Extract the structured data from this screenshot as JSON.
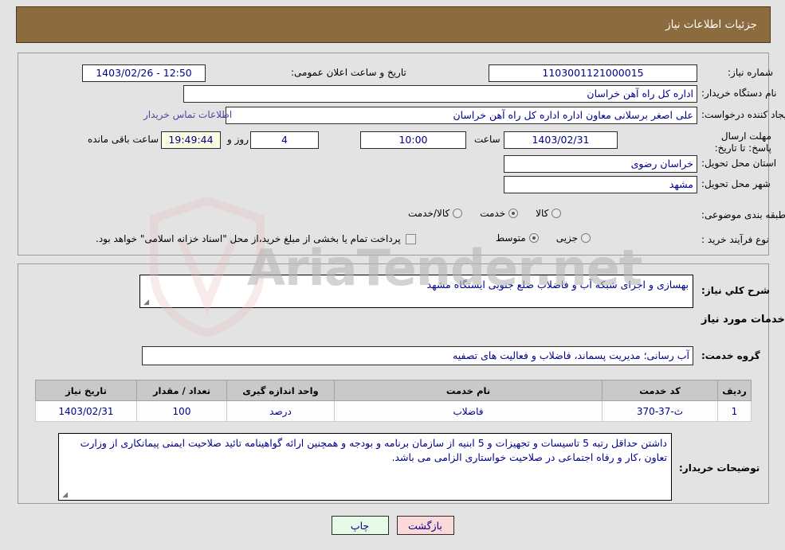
{
  "window": {
    "title": "جزئیات اطلاعات نیاز"
  },
  "watermark": {
    "text": "AriaTender.net"
  },
  "top_panel": {
    "need_number": {
      "label": "شماره نیاز:",
      "value": "1103001121000015"
    },
    "public_announce": {
      "label": "تاریخ و ساعت اعلان عمومی:",
      "value": "1403/02/26 - 12:50"
    },
    "buyer_org": {
      "label": "نام دستگاه خریدار:",
      "value": "اداره کل راه آهن خراسان"
    },
    "request_creator": {
      "label": "ایجاد کننده درخواست:",
      "value": "علی اصغر برسلانی معاون اداره اداره کل راه آهن خراسان"
    },
    "contact_link": "اطلاعات تماس خریدار",
    "deadline": {
      "label": "مهلت ارسال پاسخ: تا تاریخ:",
      "date": "1403/02/31",
      "hour_label": "ساعت",
      "hour": "10:00",
      "days": "4",
      "days_label": "روز و",
      "countdown": "19:49:44",
      "countdown_label": "ساعت باقی مانده"
    },
    "delivery_province": {
      "label": "استان محل تحویل:",
      "value": "خراسان رضوی"
    },
    "delivery_city": {
      "label": "شهر محل تحویل:",
      "value": "مشهد"
    },
    "subject_category": {
      "label": "طبقه بندی موضوعی:",
      "options": [
        "کالا",
        "خدمت",
        "کالا/خدمت"
      ],
      "selected": "خدمت"
    },
    "purchase_process": {
      "label": "نوع فرآیند خرید :",
      "options": [
        "جزیی",
        "متوسط"
      ],
      "selected": "متوسط"
    },
    "treasury_note": {
      "text": "پرداخت تمام یا بخشی از مبلغ خرید،از محل \"اسناد خزانه اسلامی\" خواهد بود.",
      "checked": false
    }
  },
  "bottom_panel": {
    "general_description": {
      "label": "شرح کلي نیاز:",
      "value": "بهسازی و اجرای شبکه آب و فاضلاب ضلع جنوبی ایستگاه مشهد"
    },
    "services_heading": "اطلاعات خدمات مورد نیاز",
    "service_group": {
      "label": "گروه خدمت:",
      "value": "آب رسانی؛ مدیریت پسماند، فاضلاب و فعالیت های تصفیه"
    },
    "table": {
      "columns": [
        "ردیف",
        "کد خدمت",
        "نام خدمت",
        "واحد اندازه گیری",
        "تعداد / مقدار",
        "تاریخ نیاز"
      ],
      "rows": [
        {
          "row": "1",
          "service_code": "ث-37-370",
          "service_name": "فاضلاب",
          "unit": "درصد",
          "quantity": "100",
          "need_date": "1403/02/31"
        }
      ]
    },
    "buyer_notes": {
      "label": "توضیحات خریدار:",
      "value": "داشتن حداقل رتبه 5 تاسیسات و تجهیزات و 5 ابنیه از سازمان برنامه و بودجه  و همچنین ارائه گواهینامه تائید صلاحیت ایمنی پیمانکاری از وزارت تعاون ،کار و رفاه اجتماعی در صلاحیت خواستاری الزامی می باشد."
    }
  },
  "footer": {
    "print_label": "چاپ",
    "back_label": "بازگشت"
  },
  "colors": {
    "titlebar": "#8c6b3f",
    "page_bg": "#e3e3e3",
    "field_text": "#00008b",
    "link": "#5b3fa0",
    "btn_print_bg": "#e6fbe6",
    "btn_back_bg": "#fbd9d9",
    "table_header_bg": "#c9c9c9",
    "countdown_bg": "#fbfbe4"
  }
}
